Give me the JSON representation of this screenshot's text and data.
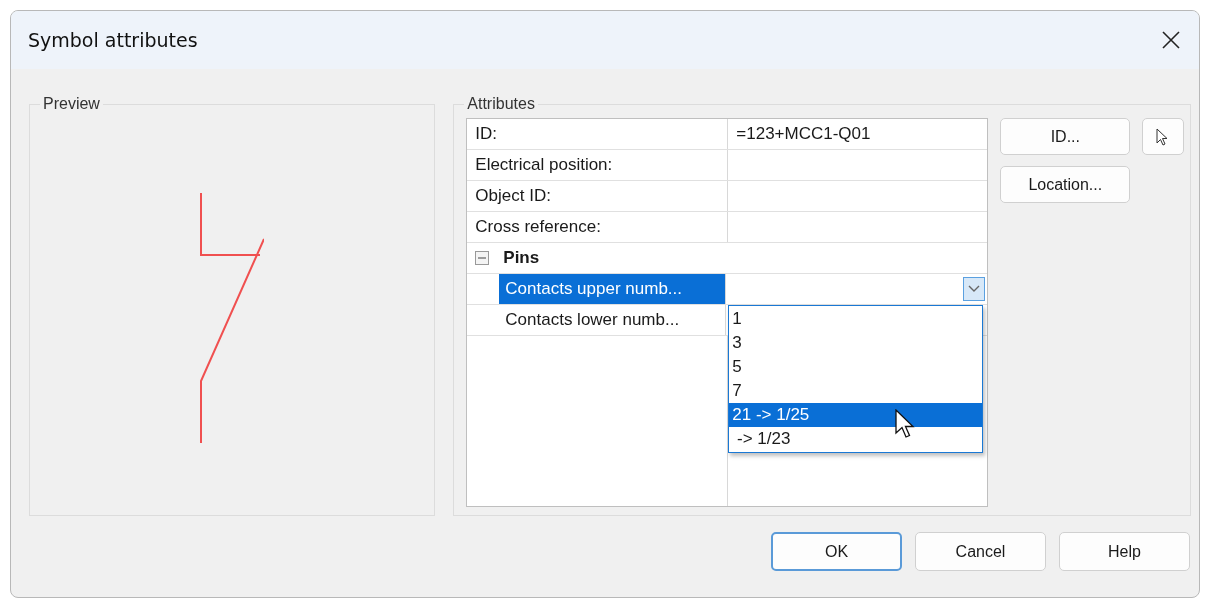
{
  "window": {
    "title": "Symbol attributes"
  },
  "preview": {
    "label": "Preview"
  },
  "attributes": {
    "label": "Attributes",
    "rows": [
      {
        "name": "ID:",
        "value": "=123+MCC1-Q01"
      },
      {
        "name": "Electrical position:"
      },
      {
        "name": "Object ID:"
      },
      {
        "name": "Cross reference:"
      }
    ],
    "group": {
      "label": "Pins",
      "expanded": true,
      "rows": [
        {
          "name": "Contacts upper numb...",
          "selected": true
        },
        {
          "name": "Contacts lower numb...",
          "selected": false
        }
      ]
    }
  },
  "dropdown": {
    "open": true,
    "options": [
      {
        "label": "1",
        "selected": false
      },
      {
        "label": "3",
        "selected": false
      },
      {
        "label": "5",
        "selected": false
      },
      {
        "label": "7",
        "selected": false
      },
      {
        "label": "21 -> 1/25",
        "selected": true
      },
      {
        "label": " -> 1/23",
        "selected": false
      }
    ]
  },
  "side_buttons": [
    "ID...",
    "Location..."
  ],
  "buttons": [
    {
      "label": "OK",
      "default": true
    },
    {
      "label": "Cancel",
      "default": false
    },
    {
      "label": "Help",
      "default": false
    }
  ]
}
